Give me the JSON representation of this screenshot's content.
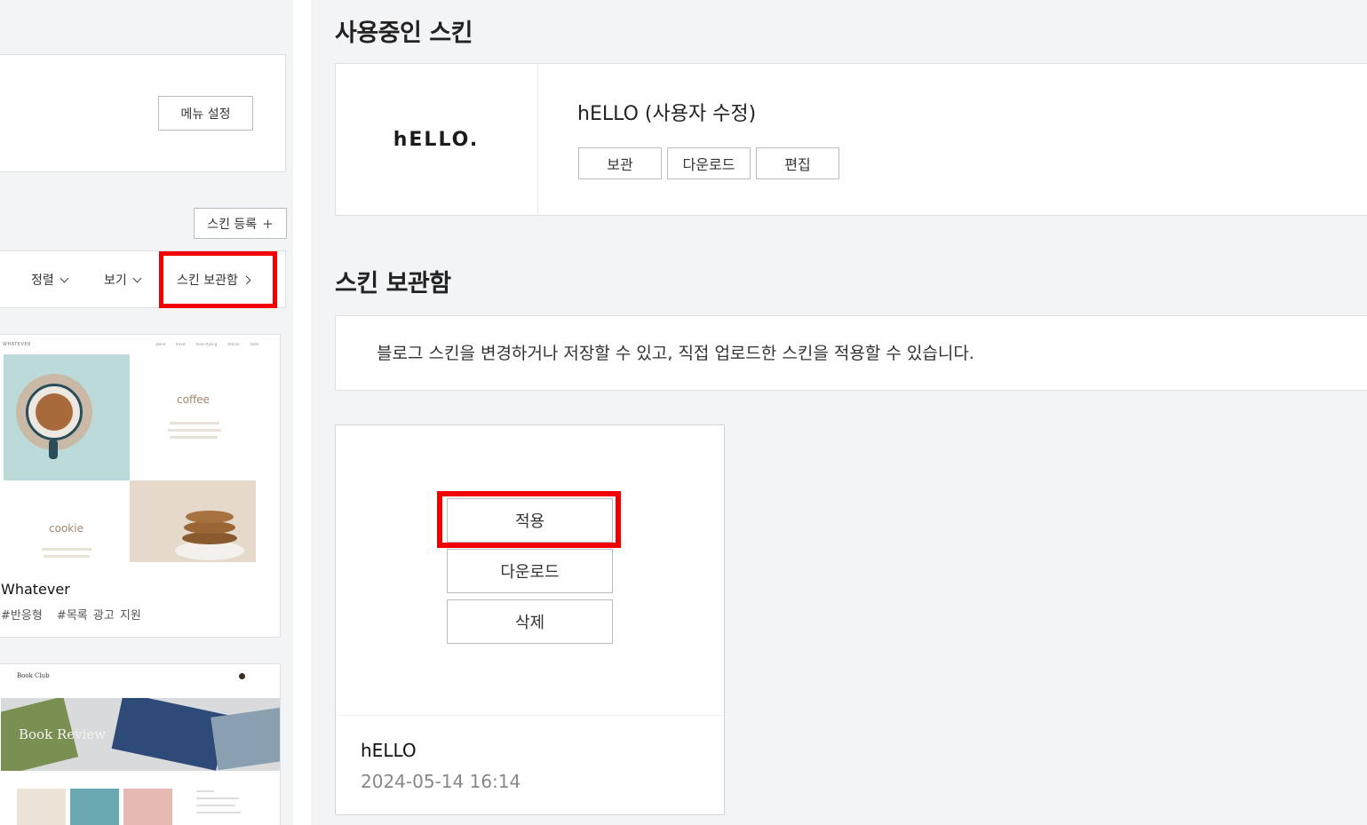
{
  "left": {
    "menu_settings_label": "메뉴 설정",
    "register_skin_label": "스킨 등록",
    "register_plus": "+",
    "sort_label": "정렬",
    "view_label": "보기",
    "archive_link_label": "스킨 보관함",
    "cards": [
      {
        "name": "Whatever",
        "tags": [
          "#반응형",
          "#목록 광고 지원"
        ],
        "preview": {
          "header": "WHATEVER",
          "nav": "about travel food-styling interior table",
          "word1": "coffee",
          "word2": "cookie"
        }
      },
      {
        "preview": {
          "header": "Book Club",
          "banner": "Book Review"
        }
      }
    ]
  },
  "current": {
    "section_title": "사용중인 스킨",
    "logo_text": "hELLO.",
    "skin_name": "hELLO (사용자 수정)",
    "buttons": {
      "archive": "보관",
      "download": "다운로드",
      "edit": "편집"
    }
  },
  "archive": {
    "section_title": "스킨 보관함",
    "description": "블로그 스킨을 변경하거나 저장할 수 있고, 직접 업로드한 스킨을 적용할 수 있습니다.",
    "card": {
      "apply_label": "적용",
      "download_label": "다운로드",
      "delete_label": "삭제",
      "name": "hELLO",
      "date": "2024-05-14 16:14"
    }
  },
  "colors": {
    "highlight": "#f20000",
    "background": "#f3f4f6",
    "border": "#dedfe3"
  }
}
